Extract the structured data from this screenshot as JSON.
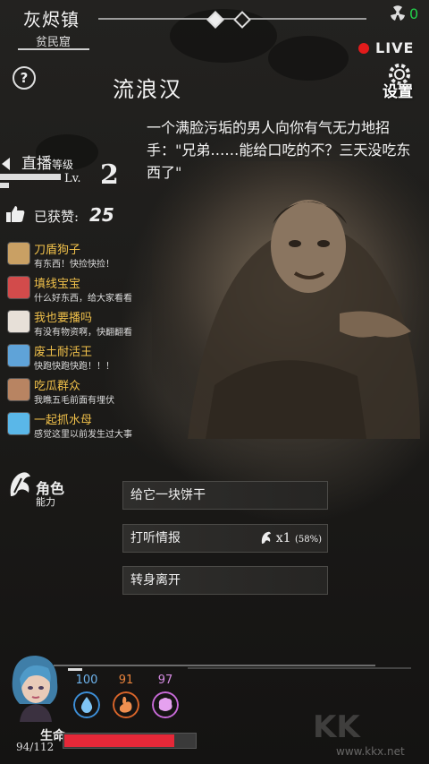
{
  "location": {
    "title": "灰烬镇",
    "subtitle": "贫民窟"
  },
  "top_counter": "0",
  "live": {
    "label": "LIVE"
  },
  "settings_label": "设置",
  "help_label": "?",
  "npc": {
    "name": "流浪汉",
    "story": "一个满脸污垢的男人向你有气无力地招手：\"兄弟……能给口吃的不？三天没吃东西了\""
  },
  "stream": {
    "title": "直播",
    "title_small": "等级",
    "level_label": "Lv.",
    "level": "2",
    "likes_label": "已获赞:",
    "likes": "25"
  },
  "chat": [
    {
      "name": "刀盾狗子",
      "msg": "有东西！快捡快捡！",
      "color": "#c9a064"
    },
    {
      "name": "填线宝宝",
      "msg": "什么好东西，给大家看看",
      "color": "#d24b4b"
    },
    {
      "name": "我也要播吗",
      "msg": "有没有物资啊，快翻翻看",
      "color": "#e7e0d8"
    },
    {
      "name": "废土耐活王",
      "msg": "快跑快跑快跑！！！",
      "color": "#5fa3d8"
    },
    {
      "name": "吃瓜群众",
      "msg": "我瞧五毛前面有埋伏",
      "color": "#b88462"
    },
    {
      "name": "一起抓水母",
      "msg": "感觉这里以前发生过大事",
      "color": "#5ab7e8"
    }
  ],
  "role": {
    "title": "角色",
    "subtitle": "能力"
  },
  "choices": [
    {
      "label": "给它一块饼干"
    },
    {
      "label": "打听情报",
      "cost": "x1",
      "chance": "(58%)"
    },
    {
      "label": "转身离开"
    }
  ],
  "stats": {
    "water": "100",
    "food": "91",
    "mind": "97",
    "colors": {
      "water": "#3d8fd8",
      "food": "#d9652a",
      "mind": "#c86ad8"
    }
  },
  "hp": {
    "label": "生命",
    "value": "94/112",
    "current": 94,
    "max": 112,
    "color": "#e52838"
  },
  "watermark": {
    "text": "KK",
    "url": "www.kkx.net"
  }
}
